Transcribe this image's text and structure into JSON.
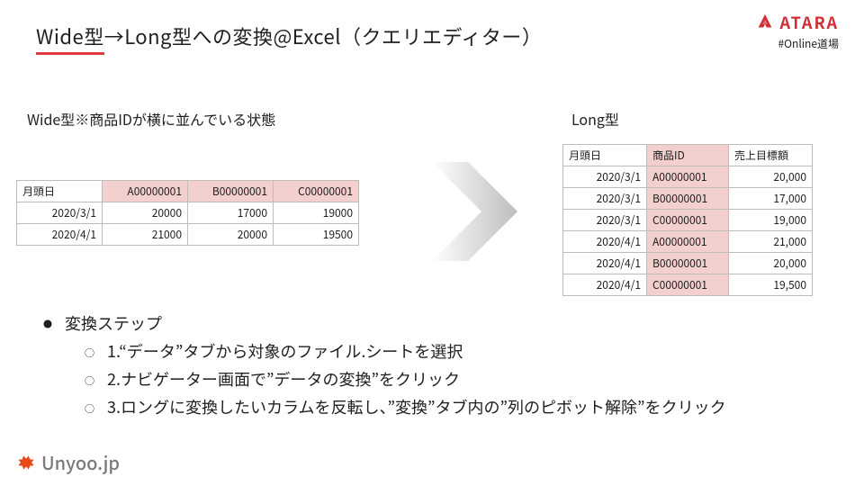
{
  "title": {
    "underlined": "Wide型",
    "rest": "→Long型への変換@Excel（クエリエディター）"
  },
  "brand": {
    "name": "ATARA",
    "tag": "#Online道場"
  },
  "subhead_left": "Wide型※商品IDが横に並んでいる状態",
  "subhead_right": "Long型",
  "wide_table": {
    "head": [
      "月頭日",
      "A00000001",
      "B00000001",
      "C00000001"
    ],
    "rows": [
      [
        "2020/3/1",
        "20000",
        "17000",
        "19000"
      ],
      [
        "2020/4/1",
        "21000",
        "20000",
        "19500"
      ]
    ]
  },
  "long_table": {
    "head": [
      "月頭日",
      "商品ID",
      "売上目標額"
    ],
    "rows": [
      [
        "2020/3/1",
        "A00000001",
        "20,000"
      ],
      [
        "2020/3/1",
        "B00000001",
        "17,000"
      ],
      [
        "2020/3/1",
        "C00000001",
        "19,000"
      ],
      [
        "2020/4/1",
        "A00000001",
        "21,000"
      ],
      [
        "2020/4/1",
        "B00000001",
        "20,000"
      ],
      [
        "2020/4/1",
        "C00000001",
        "19,500"
      ]
    ]
  },
  "bullets": {
    "heading": "変換ステップ",
    "items": [
      "1.“データ”タブから対象のファイル.シートを選択",
      "2.ナビゲーター画面で”データの変換”をクリック",
      "3.ロングに変換したいカラムを反転し、”変換”タブ内の”列のピボット解除”をクリック"
    ]
  },
  "footer": {
    "label": "Unyoo.jp"
  },
  "chart_data": [
    {
      "type": "table",
      "title": "Wide型",
      "columns": [
        "月頭日",
        "A00000001",
        "B00000001",
        "C00000001"
      ],
      "rows": [
        [
          "2020/3/1",
          20000,
          17000,
          19000
        ],
        [
          "2020/4/1",
          21000,
          20000,
          19500
        ]
      ]
    },
    {
      "type": "table",
      "title": "Long型",
      "columns": [
        "月頭日",
        "商品ID",
        "売上目標額"
      ],
      "rows": [
        [
          "2020/3/1",
          "A00000001",
          20000
        ],
        [
          "2020/3/1",
          "B00000001",
          17000
        ],
        [
          "2020/3/1",
          "C00000001",
          19000
        ],
        [
          "2020/4/1",
          "A00000001",
          21000
        ],
        [
          "2020/4/1",
          "B00000001",
          20000
        ],
        [
          "2020/4/1",
          "C00000001",
          19500
        ]
      ]
    }
  ]
}
